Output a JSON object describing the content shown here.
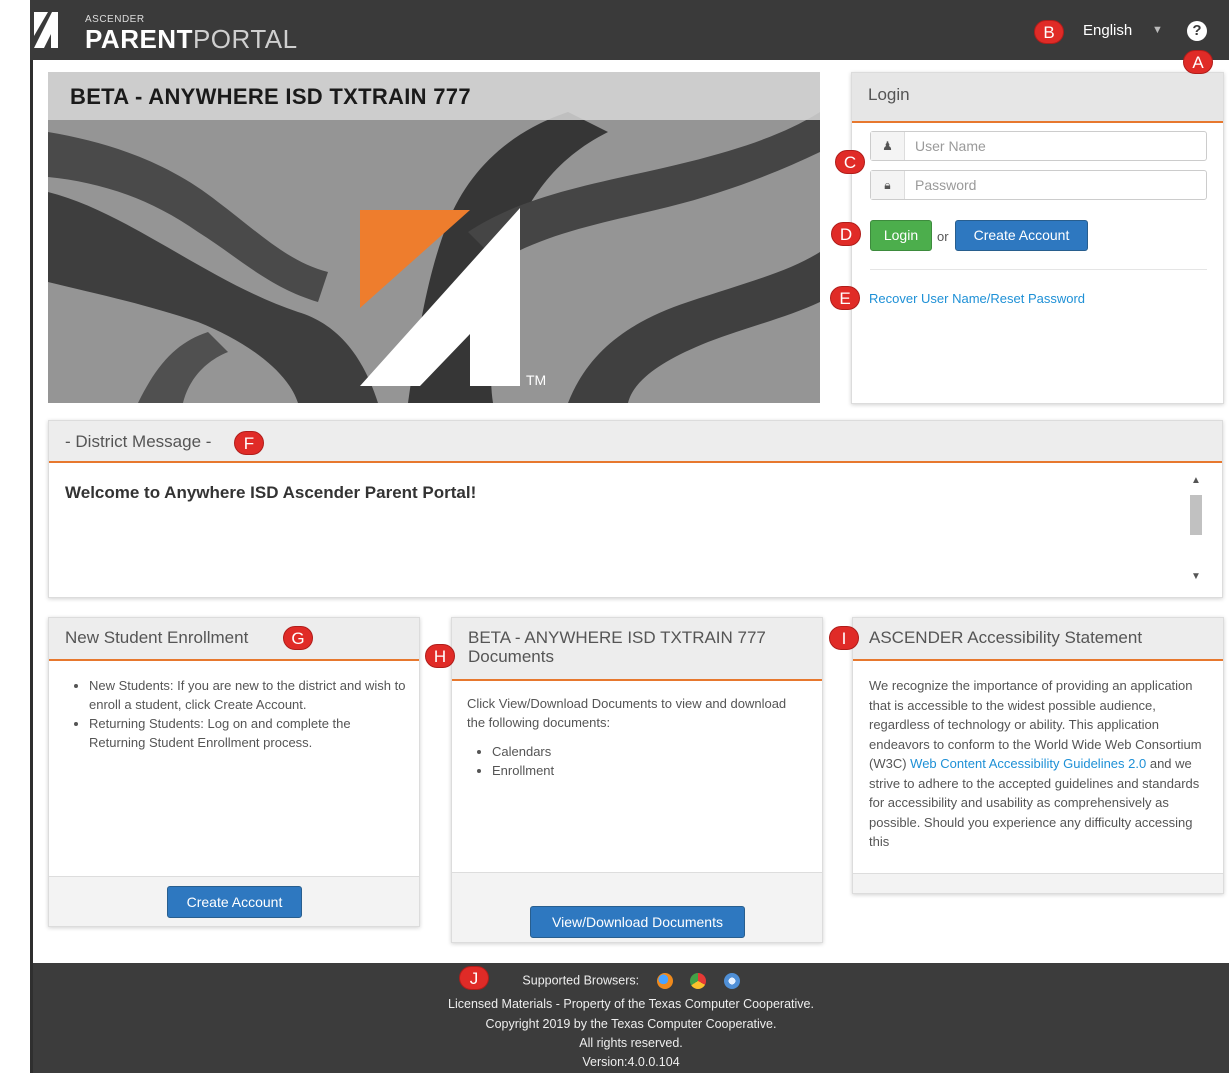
{
  "header": {
    "brand_small": "ASCENDER",
    "brand_bold": "PARENT",
    "brand_light": "PORTAL",
    "language": "English",
    "help_icon": "question-circle-icon"
  },
  "markers": {
    "a": "A",
    "b": "B",
    "c": "C",
    "d": "D",
    "e": "E",
    "f": "F",
    "g": "G",
    "h": "H",
    "i": "I",
    "j": "J"
  },
  "hero": {
    "title": "BETA - ANYWHERE ISD TXTRAIN 777",
    "trademark": "TM"
  },
  "login": {
    "heading": "Login",
    "username_placeholder": "User Name",
    "password_placeholder": "Password",
    "login_label": "Login",
    "or_text": "or",
    "create_account_label": "Create Account",
    "recover_link": "Recover User Name/Reset Password"
  },
  "district": {
    "heading": "- District Message -",
    "message": "Welcome to Anywhere ISD Ascender Parent Portal!"
  },
  "enrollment": {
    "heading": "New Student Enrollment",
    "items": [
      "New Students: If you are new to the district and wish to enroll a student, click Create Account.",
      "Returning Students: Log on and complete the Returning Student Enrollment process."
    ],
    "button": "Create Account"
  },
  "documents": {
    "heading_line1": "BETA - ANYWHERE ISD TXTRAIN 777",
    "heading_line2": "Documents",
    "intro": "Click View/Download Documents to view and download the following documents:",
    "items": [
      "Calendars",
      "Enrollment"
    ],
    "button": "View/Download Documents"
  },
  "accessibility": {
    "heading": "ASCENDER Accessibility Statement",
    "text_before": "We recognize the importance of providing an application that is accessible to the widest possible audience, regardless of technology or ability. This application endeavors to conform to the World Wide Web Consortium (W3C) ",
    "link": "Web Content Accessibility Guidelines 2.0",
    "text_after": " and we strive to adhere to the accepted guidelines and standards for accessibility and usability as comprehensively as possible. Should you experience any difficulty accessing this"
  },
  "footer": {
    "browsers_label": "Supported Browsers:",
    "browser_icons": [
      "firefox-icon",
      "chrome-icon",
      "safari-icon"
    ],
    "license": "Licensed Materials - Property of the Texas Computer Cooperative.",
    "copyright": "Copyright 2019 by the Texas Computer Cooperative.",
    "rights": "All rights reserved.",
    "version": "Version:4.0.0.104"
  },
  "colors": {
    "header_bg": "#3a3a3a",
    "accent_orange": "#e7782e",
    "login_green": "#4cae4c",
    "primary_blue": "#2e78c0",
    "link_blue": "#1e90d6",
    "marker_red": "#e02b27"
  }
}
